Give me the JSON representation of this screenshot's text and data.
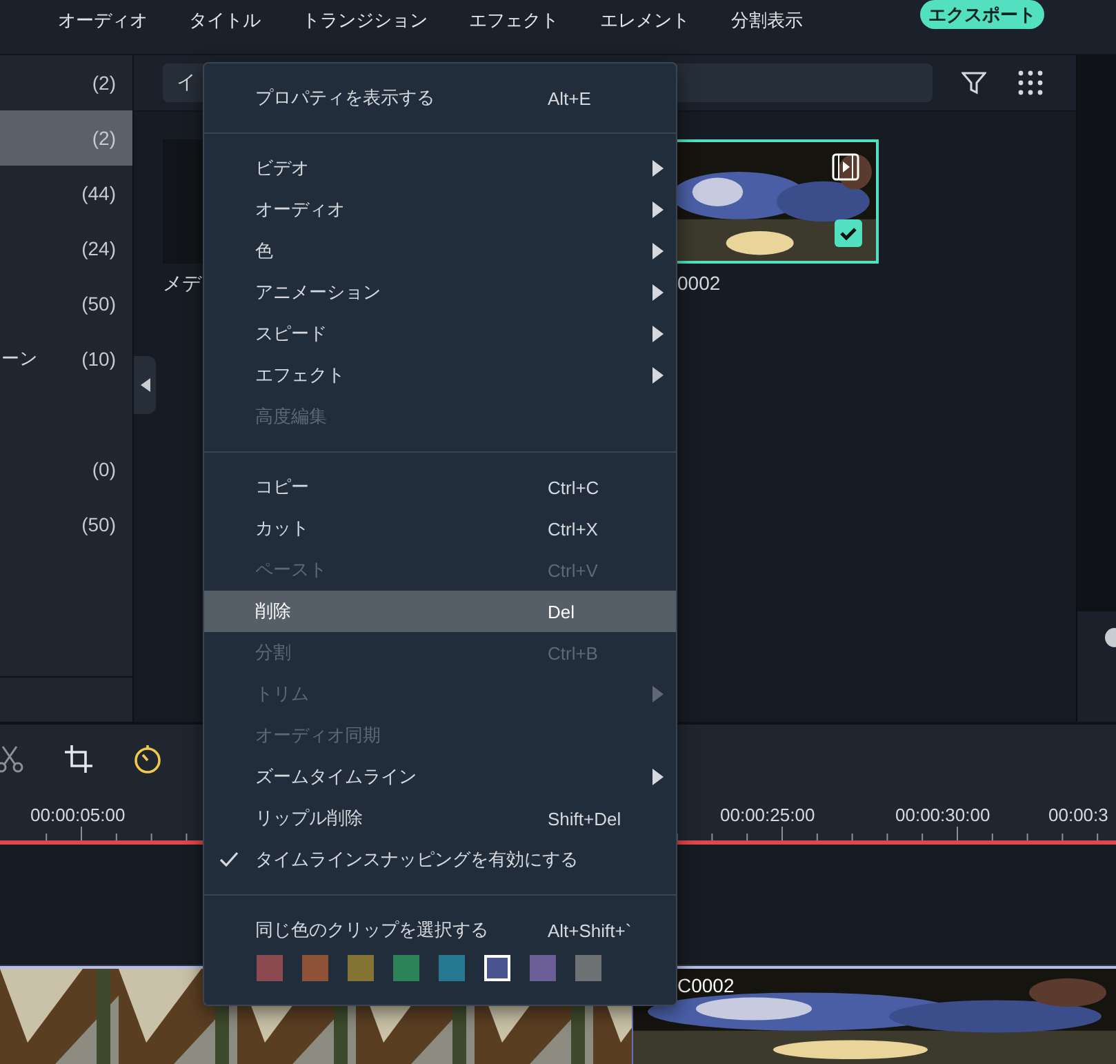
{
  "top_menu": [
    {
      "label": "オーディオ"
    },
    {
      "label": "タイトル"
    },
    {
      "label": "トランジション"
    },
    {
      "label": "エフェクト"
    },
    {
      "label": "エレメント"
    },
    {
      "label": "分割表示"
    }
  ],
  "export_button": {
    "label": "エクスポート"
  },
  "sidebar": {
    "items": [
      {
        "count": "(2)",
        "selected": false
      },
      {
        "count": "(2)",
        "selected": true
      },
      {
        "count": "(44)",
        "selected": false
      },
      {
        "count": "(24)",
        "selected": false
      },
      {
        "count": "(50)",
        "selected": false
      },
      {
        "label": "ーン",
        "count": "(10)",
        "selected": false
      },
      {
        "selected": false
      },
      {
        "count": "(0)",
        "selected": false
      },
      {
        "count": "(50)",
        "selected": false
      }
    ]
  },
  "media": {
    "search": {
      "value": "イ"
    },
    "items": [
      {
        "label": "メデ",
        "selected": false
      },
      {
        "label": "0002",
        "selected": true
      }
    ]
  },
  "timeline": {
    "ruler": [
      "00:00:05:00",
      "00:00:25:00",
      "00:00:30:00",
      "00:00:3"
    ],
    "clips": [
      {
        "kind": "tent"
      },
      {
        "kind": "fabric",
        "label": "C0002"
      }
    ]
  },
  "context_menu": {
    "groups": [
      {
        "items": [
          {
            "label": "プロパティを表示する",
            "shortcut": "Alt+E",
            "submenu": false,
            "disabled": false,
            "highlighted": false,
            "checked": false
          }
        ]
      },
      {
        "items": [
          {
            "label": "ビデオ",
            "submenu": true,
            "disabled": false,
            "highlighted": false,
            "checked": false
          },
          {
            "label": "オーディオ",
            "submenu": true,
            "disabled": false,
            "highlighted": false,
            "checked": false
          },
          {
            "label": "色",
            "submenu": true,
            "disabled": false,
            "highlighted": false,
            "checked": false
          },
          {
            "label": "アニメーション",
            "submenu": true,
            "disabled": false,
            "highlighted": false,
            "checked": false
          },
          {
            "label": "スピード",
            "submenu": true,
            "disabled": false,
            "highlighted": false,
            "checked": false
          },
          {
            "label": "エフェクト",
            "submenu": true,
            "disabled": false,
            "highlighted": false,
            "checked": false
          },
          {
            "label": "高度編集",
            "submenu": false,
            "disabled": true,
            "highlighted": false,
            "checked": false
          }
        ]
      },
      {
        "items": [
          {
            "label": "コピー",
            "shortcut": "Ctrl+C",
            "submenu": false,
            "disabled": false,
            "highlighted": false,
            "checked": false
          },
          {
            "label": "カット",
            "shortcut": "Ctrl+X",
            "submenu": false,
            "disabled": false,
            "highlighted": false,
            "checked": false
          },
          {
            "label": "ペースト",
            "shortcut": "Ctrl+V",
            "submenu": false,
            "disabled": true,
            "highlighted": false,
            "checked": false
          },
          {
            "label": "削除",
            "shortcut": "Del",
            "submenu": false,
            "disabled": false,
            "highlighted": true,
            "checked": false
          },
          {
            "label": "分割",
            "shortcut": "Ctrl+B",
            "submenu": false,
            "disabled": true,
            "highlighted": false,
            "checked": false
          },
          {
            "label": "トリム",
            "submenu": true,
            "disabled": true,
            "highlighted": false,
            "checked": false
          },
          {
            "label": "オーディオ同期",
            "submenu": false,
            "disabled": true,
            "highlighted": false,
            "checked": false
          },
          {
            "label": "ズームタイムライン",
            "submenu": true,
            "disabled": false,
            "highlighted": false,
            "checked": false
          },
          {
            "label": "リップル削除",
            "shortcut": "Shift+Del",
            "submenu": false,
            "disabled": false,
            "highlighted": false,
            "checked": false
          },
          {
            "label": "タイムラインスナッピングを有効にする",
            "submenu": false,
            "disabled": false,
            "highlighted": false,
            "checked": true
          }
        ]
      },
      {
        "items": [
          {
            "label": "同じ色のクリップを選択する",
            "shortcut": "Alt+Shift+`",
            "submenu": false,
            "disabled": false,
            "highlighted": false,
            "checked": false
          }
        ],
        "swatches": [
          {
            "color": "#8b4a4f",
            "selected": false
          },
          {
            "color": "#8e5238",
            "selected": false
          },
          {
            "color": "#857534",
            "selected": false
          },
          {
            "color": "#2b8357",
            "selected": false
          },
          {
            "color": "#267790",
            "selected": false
          },
          {
            "color": "#4a5491",
            "selected": true
          },
          {
            "color": "#6a5f96",
            "selected": false
          },
          {
            "color": "#6e7174",
            "selected": false
          }
        ]
      }
    ]
  }
}
